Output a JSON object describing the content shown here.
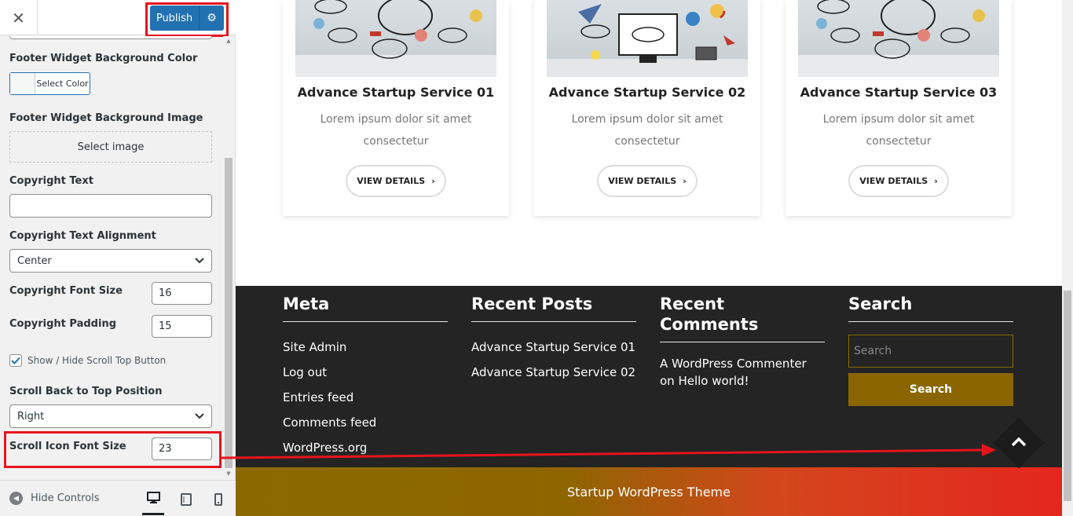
{
  "customizer": {
    "close_icon": "close-icon",
    "publish_label": "Publish",
    "settings_icon": "gear-icon",
    "fields": {
      "footer_bg_color_label": "Footer Widget Background Color",
      "select_color_label": "Select Color",
      "footer_bg_image_label": "Footer Widget Background Image",
      "select_image_label": "Select image",
      "copyright_text_label": "Copyright Text",
      "copyright_text_value": "",
      "copyright_alignment_label": "Copyright Text Alignment",
      "copyright_alignment_value": "Center",
      "copyright_font_size_label": "Copyright Font Size",
      "copyright_font_size_value": "16",
      "copyright_padding_label": "Copyright Padding",
      "copyright_padding_value": "15",
      "scroll_top_checkbox_label": "Show / Hide Scroll Top Button",
      "scroll_top_checked": true,
      "scroll_position_label": "Scroll Back to Top Position",
      "scroll_position_value": "Right",
      "scroll_icon_font_size_label": "Scroll Icon Font Size",
      "scroll_icon_font_size_value": "23"
    },
    "footer": {
      "hide_controls_label": "Hide Controls",
      "devices": [
        "desktop",
        "tablet",
        "mobile"
      ],
      "active_device": "desktop"
    }
  },
  "preview": {
    "services": [
      {
        "title": "Advance Startup Service 01",
        "desc": "Lorem ipsum dolor sit amet consectetur",
        "button": "VIEW DETAILS"
      },
      {
        "title": "Advance Startup Service 02",
        "desc": "Lorem ipsum dolor sit amet consectetur",
        "button": "VIEW DETAILS"
      },
      {
        "title": "Advance Startup Service 03",
        "desc": "Lorem ipsum dolor sit amet consectetur",
        "button": "VIEW DETAILS"
      }
    ],
    "widgets": {
      "meta_title": "Meta",
      "meta_links": [
        "Site Admin",
        "Log out",
        "Entries feed",
        "Comments feed",
        "WordPress.org"
      ],
      "recent_posts_title": "Recent Posts",
      "recent_posts": [
        "Advance Startup Service 01",
        "Advance Startup Service 02"
      ],
      "recent_comments_title": "Recent Comments",
      "recent_comment": "A WordPress Commenter on Hello world!",
      "search_title": "Search",
      "search_placeholder": "Search",
      "search_button": "Search"
    },
    "copyright_text": "Startup WordPress Theme",
    "colors": {
      "publish": "#2271b1",
      "highlight": "#e8141c",
      "footer_bg": "#242424",
      "search_button": "#8a6500"
    }
  }
}
